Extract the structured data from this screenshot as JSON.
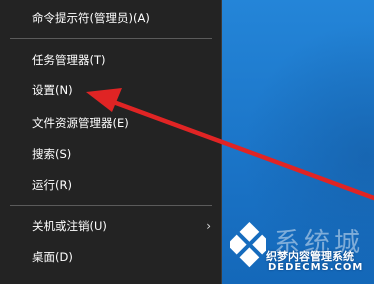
{
  "menu": {
    "items": [
      {
        "label": "命令提示符(管理员)(A)"
      },
      {
        "label": "任务管理器(T)"
      },
      {
        "label": "设置(N)"
      },
      {
        "label": "文件资源管理器(E)"
      },
      {
        "label": "搜索(S)"
      },
      {
        "label": "运行(R)"
      },
      {
        "label": "关机或注销(U)",
        "has_submenu": true
      },
      {
        "label": "桌面(D)"
      }
    ]
  },
  "watermark": {
    "title": "系统城",
    "subtitle": "织梦内容管理系统",
    "url": "DEDECMS.COM"
  },
  "colors": {
    "menu_background": "#232323",
    "desktop_blue": "#1e78c8",
    "annotation_arrow": "#e02424"
  }
}
